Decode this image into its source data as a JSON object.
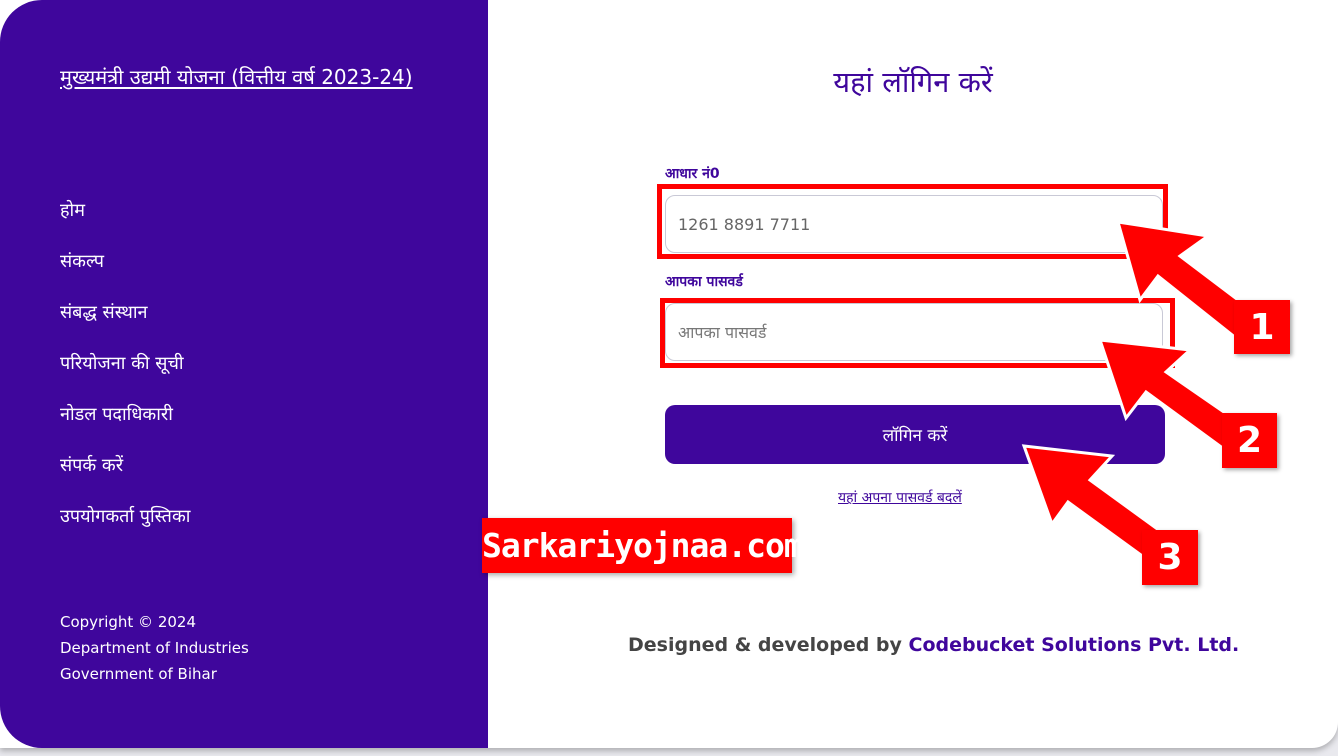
{
  "sidebar": {
    "title": "मुख्यमंत्री उद्यमी योजना (वित्तीय वर्ष 2023-24)",
    "nav": [
      {
        "label": "होम"
      },
      {
        "label": "संकल्प"
      },
      {
        "label": "संबद्ध संस्थान"
      },
      {
        "label": "परियोजना की सूची"
      },
      {
        "label": "नोडल पदाधिकारी"
      },
      {
        "label": "संपर्क करें"
      },
      {
        "label": "उपयोगकर्ता पुस्तिका"
      }
    ],
    "copyright": [
      "Copyright © 2024",
      "Department of Industries",
      "Government of Bihar"
    ]
  },
  "login": {
    "heading": "यहां लॉगिन करें",
    "aadhaar_label": "आधार नं0",
    "aadhaar_value": "1261 8891 7711",
    "password_label": "आपका पासवर्ड",
    "password_placeholder": "आपका पासवर्ड",
    "submit_label": "लॉगिन करें",
    "change_password_link": "यहां अपना पासवर्ड बदलें"
  },
  "footer": {
    "prefix": "Designed & developed by ",
    "org": "Codebucket Solutions Pvt. Ltd."
  },
  "annotations": {
    "badges": [
      "1",
      "2",
      "3"
    ],
    "watermark": "Sarkariyojnaa.com",
    "color": "#ff0000"
  },
  "colors": {
    "brand": "#3f069c"
  }
}
